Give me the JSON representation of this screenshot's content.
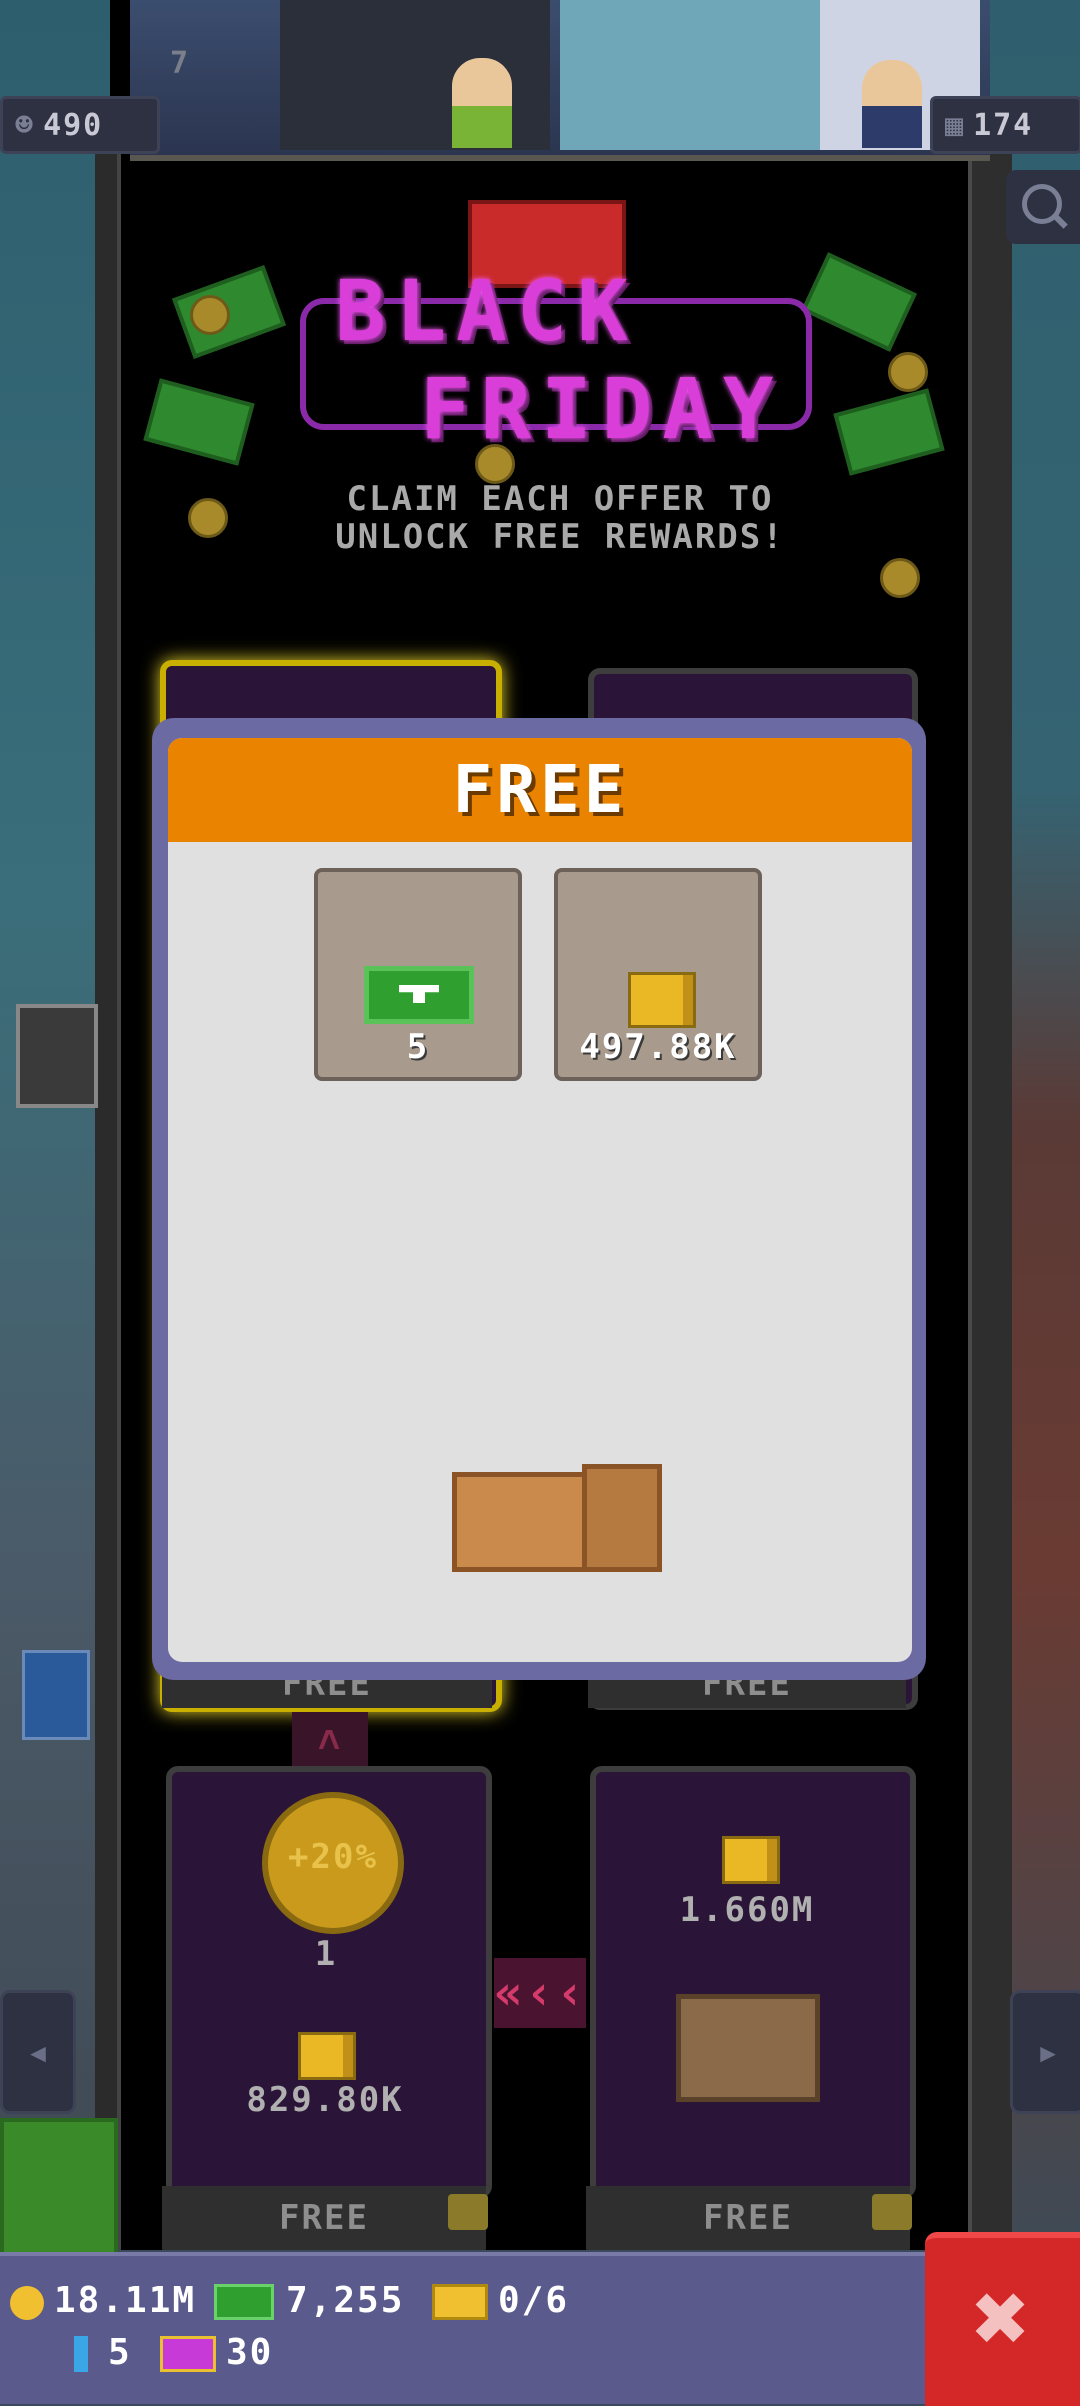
{
  "top_hud": {
    "population": "490",
    "floors": "174",
    "floor_number": "7"
  },
  "event": {
    "title_line1": "BLACK",
    "title_line2": "FRIDAY",
    "subtitle_line1": "CLAIM EACH OFFER TO",
    "subtitle_line2": "UNLOCK FREE REWARDS!"
  },
  "modal": {
    "header": "FREE",
    "rewards": [
      {
        "icon": "tower-bux-icon",
        "value": "5"
      },
      {
        "icon": "gold-coins-icon",
        "value": "497.88K"
      }
    ],
    "chest": "wooden-crate-icon"
  },
  "offers": {
    "bottom_left": {
      "boost_label": "+20%",
      "boost_count": "1",
      "coins": "829.80K",
      "button": "FREE"
    },
    "bottom_right": {
      "coins": "1.660M",
      "button": "FREE"
    },
    "top_left_button": "FREE",
    "top_right_button": "FREE",
    "arrows": "«‹‹"
  },
  "resources": {
    "coins": "18.11M",
    "bux": "7,255",
    "tickets": "0/6",
    "keys": "5",
    "vip": "30"
  },
  "colors": {
    "modal_header": "#ea8400",
    "neon_pink": "#d93fd8",
    "close_button": "#d42828"
  }
}
